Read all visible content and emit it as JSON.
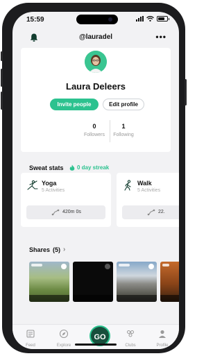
{
  "status_bar": {
    "time": "15:59"
  },
  "header": {
    "username": "@lauradel",
    "more_label": "•••"
  },
  "profile": {
    "name": "Laura Deleers",
    "invite_label": "Invite people",
    "edit_label": "Edit profile",
    "followers_count": "0",
    "followers_label": "Followers",
    "following_count": "1",
    "following_label": "Following"
  },
  "sweat_stats": {
    "title": "Sweat stats",
    "streak": "0 day streak",
    "sports": [
      {
        "name": "Yoga",
        "activities": "5 Activities",
        "metric": "420m 0s",
        "icon": "yoga-icon"
      },
      {
        "name": "Walk",
        "activities": "5 Activities",
        "metric": "22.",
        "icon": "walk-icon"
      }
    ]
  },
  "shares": {
    "title": "Shares",
    "count": "(5)",
    "chevron": "›"
  },
  "tabbar": {
    "feed": "Feed",
    "explore": "Explore",
    "go": "GO",
    "clubs": "Clubs",
    "profile": "Profile"
  },
  "colors": {
    "accent": "#2cc28f",
    "go_button": "#174f3c"
  }
}
